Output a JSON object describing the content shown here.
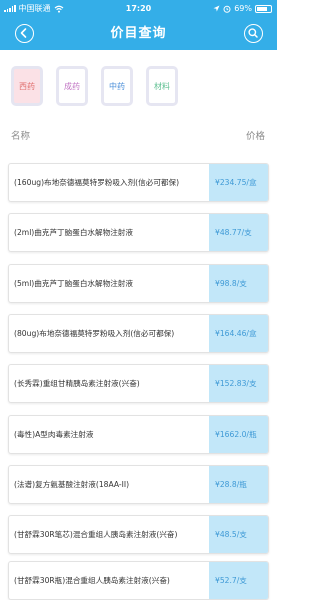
{
  "status_bar": {
    "carrier": "中国联通",
    "time": "17:20",
    "battery": "69%"
  },
  "header": {
    "title": "价目查询"
  },
  "categories": [
    {
      "label": "西药",
      "color": "#e0706f",
      "active": true
    },
    {
      "label": "成药",
      "color": "#c277c4",
      "active": false
    },
    {
      "label": "中药",
      "color": "#4b8fd9",
      "active": false
    },
    {
      "label": "材料",
      "color": "#5fc092",
      "active": false
    }
  ],
  "columns": {
    "name": "名称",
    "price": "价格"
  },
  "items": [
    {
      "name": "(160ug)布地奈德福莫特罗粉吸入剂(信必可都保)",
      "price": "¥234.75/盒"
    },
    {
      "name": "(2ml)曲克芦丁脑蛋白水解物注射液",
      "price": "¥48.77/支"
    },
    {
      "name": "(5ml)曲克芦丁脑蛋白水解物注射液",
      "price": "¥98.8/支"
    },
    {
      "name": "(80ug)布地奈德福莫特罗粉吸入剂(信必可都保)",
      "price": "¥164.46/盒"
    },
    {
      "name": "(长秀霖)重组甘精胰岛素注射液(兴奋)",
      "price": "¥152.83/支"
    },
    {
      "name": "(毒性)A型肉毒素注射液",
      "price": "¥1662.0/瓶"
    },
    {
      "name": "(法谱)复方氨基酸注射液(18AA-II)",
      "price": "¥28.8/瓶"
    },
    {
      "name": "(甘舒霖30R笔芯)混合重组人胰岛素注射液(兴奋)",
      "price": "¥48.5/支"
    },
    {
      "name": "(甘舒霖30R瓶)混合重组人胰岛素注射液(兴奋)",
      "price": "¥52.7/支"
    }
  ]
}
